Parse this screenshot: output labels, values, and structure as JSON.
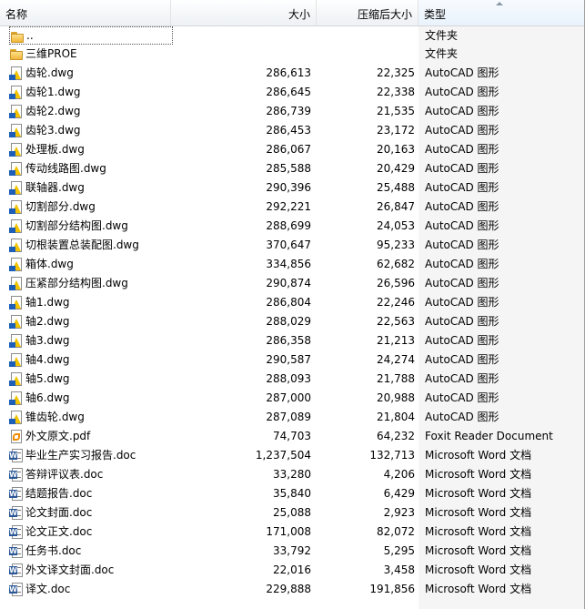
{
  "columns": {
    "name": "名称",
    "size": "大小",
    "packed": "压缩后大小",
    "type": "类型"
  },
  "rows": [
    {
      "name": "..",
      "size": "",
      "packed": "",
      "type": "文件夹",
      "icon": "folder-icon"
    },
    {
      "name": "三维PROE",
      "size": "",
      "packed": "",
      "type": "文件夹",
      "icon": "folder-icon"
    },
    {
      "name": "齿轮.dwg",
      "size": "286,613",
      "packed": "22,325",
      "type": "AutoCAD 图形",
      "icon": "dwg-file-icon"
    },
    {
      "name": "齿轮1.dwg",
      "size": "286,645",
      "packed": "22,338",
      "type": "AutoCAD 图形",
      "icon": "dwg-file-icon"
    },
    {
      "name": "齿轮2.dwg",
      "size": "286,739",
      "packed": "21,535",
      "type": "AutoCAD 图形",
      "icon": "dwg-file-icon"
    },
    {
      "name": "齿轮3.dwg",
      "size": "286,453",
      "packed": "23,172",
      "type": "AutoCAD 图形",
      "icon": "dwg-file-icon"
    },
    {
      "name": "处理板.dwg",
      "size": "286,067",
      "packed": "20,163",
      "type": "AutoCAD 图形",
      "icon": "dwg-file-icon"
    },
    {
      "name": "传动线路图.dwg",
      "size": "285,588",
      "packed": "20,429",
      "type": "AutoCAD 图形",
      "icon": "dwg-file-icon"
    },
    {
      "name": "联轴器.dwg",
      "size": "290,396",
      "packed": "25,488",
      "type": "AutoCAD 图形",
      "icon": "dwg-file-icon"
    },
    {
      "name": "切割部分.dwg",
      "size": "292,221",
      "packed": "26,847",
      "type": "AutoCAD 图形",
      "icon": "dwg-file-icon"
    },
    {
      "name": "切割部分结构图.dwg",
      "size": "288,699",
      "packed": "24,053",
      "type": "AutoCAD 图形",
      "icon": "dwg-file-icon"
    },
    {
      "name": "切根装置总装配图.dwg",
      "size": "370,647",
      "packed": "95,233",
      "type": "AutoCAD 图形",
      "icon": "dwg-file-icon"
    },
    {
      "name": "箱体.dwg",
      "size": "334,856",
      "packed": "62,682",
      "type": "AutoCAD 图形",
      "icon": "dwg-file-icon"
    },
    {
      "name": "压紧部分结构图.dwg",
      "size": "290,874",
      "packed": "26,596",
      "type": "AutoCAD 图形",
      "icon": "dwg-file-icon"
    },
    {
      "name": "轴1.dwg",
      "size": "286,804",
      "packed": "22,246",
      "type": "AutoCAD 图形",
      "icon": "dwg-file-icon"
    },
    {
      "name": "轴2.dwg",
      "size": "288,029",
      "packed": "22,563",
      "type": "AutoCAD 图形",
      "icon": "dwg-file-icon"
    },
    {
      "name": "轴3.dwg",
      "size": "286,358",
      "packed": "21,213",
      "type": "AutoCAD 图形",
      "icon": "dwg-file-icon"
    },
    {
      "name": "轴4.dwg",
      "size": "290,587",
      "packed": "24,274",
      "type": "AutoCAD 图形",
      "icon": "dwg-file-icon"
    },
    {
      "name": "轴5.dwg",
      "size": "288,093",
      "packed": "21,788",
      "type": "AutoCAD 图形",
      "icon": "dwg-file-icon"
    },
    {
      "name": "轴6.dwg",
      "size": "287,000",
      "packed": "20,988",
      "type": "AutoCAD 图形",
      "icon": "dwg-file-icon"
    },
    {
      "name": "锥齿轮.dwg",
      "size": "287,089",
      "packed": "21,804",
      "type": "AutoCAD 图形",
      "icon": "dwg-file-icon"
    },
    {
      "name": "外文原文.pdf",
      "size": "74,703",
      "packed": "64,232",
      "type": "Foxit Reader Document",
      "icon": "pdf-file-icon"
    },
    {
      "name": "毕业生产实习报告.doc",
      "size": "1,237,504",
      "packed": "132,713",
      "type": "Microsoft Word 文档",
      "icon": "word-doc-icon"
    },
    {
      "name": "答辩评议表.doc",
      "size": "33,280",
      "packed": "4,206",
      "type": "Microsoft Word 文档",
      "icon": "word-doc-icon"
    },
    {
      "name": "结题报告.doc",
      "size": "35,840",
      "packed": "6,429",
      "type": "Microsoft Word 文档",
      "icon": "word-doc-icon"
    },
    {
      "name": "论文封面.doc",
      "size": "25,088",
      "packed": "2,923",
      "type": "Microsoft Word 文档",
      "icon": "word-doc-icon"
    },
    {
      "name": "论文正文.doc",
      "size": "171,008",
      "packed": "82,072",
      "type": "Microsoft Word 文档",
      "icon": "word-doc-icon"
    },
    {
      "name": "任务书.doc",
      "size": "33,792",
      "packed": "5,295",
      "type": "Microsoft Word 文档",
      "icon": "word-doc-icon"
    },
    {
      "name": "外文译文封面.doc",
      "size": "22,016",
      "packed": "3,458",
      "type": "Microsoft Word 文档",
      "icon": "word-doc-icon"
    },
    {
      "name": "译文.doc",
      "size": "229,888",
      "packed": "191,856",
      "type": "Microsoft Word 文档",
      "icon": "word-doc-icon"
    }
  ]
}
